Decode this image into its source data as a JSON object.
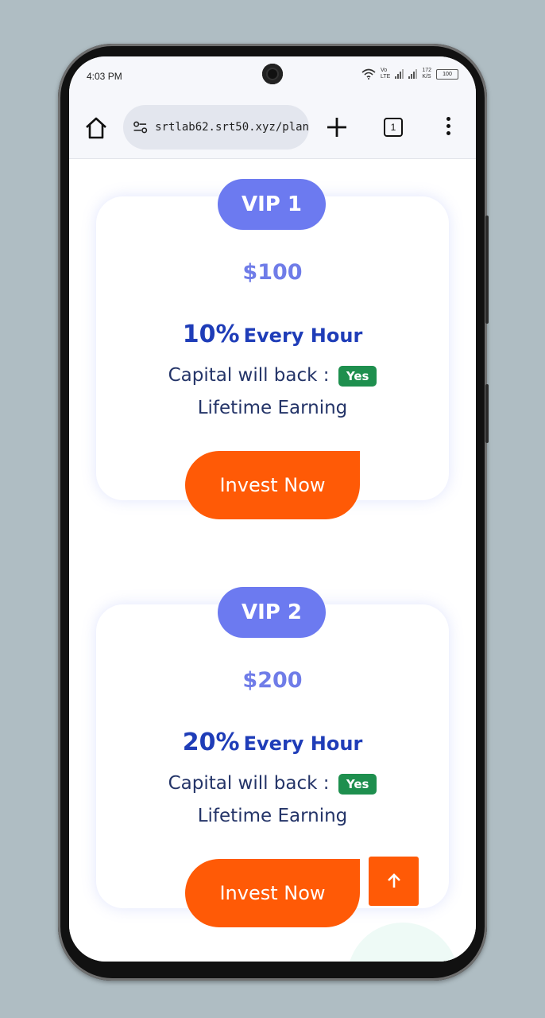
{
  "status_bar": {
    "time": "4:03 PM",
    "network_label_top": "Vo",
    "network_label_bottom": "LTE",
    "speed_top": "172",
    "speed_bottom": "K/S",
    "battery": "100"
  },
  "browser": {
    "url": "srtlab62.srt50.xyz/plan",
    "tab_count": "1",
    "icons": [
      "home-icon",
      "site-settings-icon",
      "plus-icon",
      "tabs-icon",
      "more-vert-icon"
    ]
  },
  "plans": [
    {
      "vip": "VIP 1",
      "price": "$100",
      "rate_pct": "10%",
      "rate_label": "Every Hour",
      "capital_text": "Capital will back :",
      "capital_badge": "Yes",
      "lifetime": "Lifetime Earning",
      "cta": "Invest Now"
    },
    {
      "vip": "VIP 2",
      "price": "$200",
      "rate_pct": "20%",
      "rate_label": "Every Hour",
      "capital_text": "Capital will back :",
      "capital_badge": "Yes",
      "lifetime": "Lifetime Earning",
      "cta": "Invest Now"
    }
  ],
  "scroll_top_icon": "arrow-up-icon",
  "colors": {
    "vip_tab": "#6c7af0",
    "price": "#6f7ce8",
    "rate": "#1f3db8",
    "cta": "#ff5a06",
    "badge_yes": "#1e8f4e",
    "background": "#afbdc3"
  }
}
